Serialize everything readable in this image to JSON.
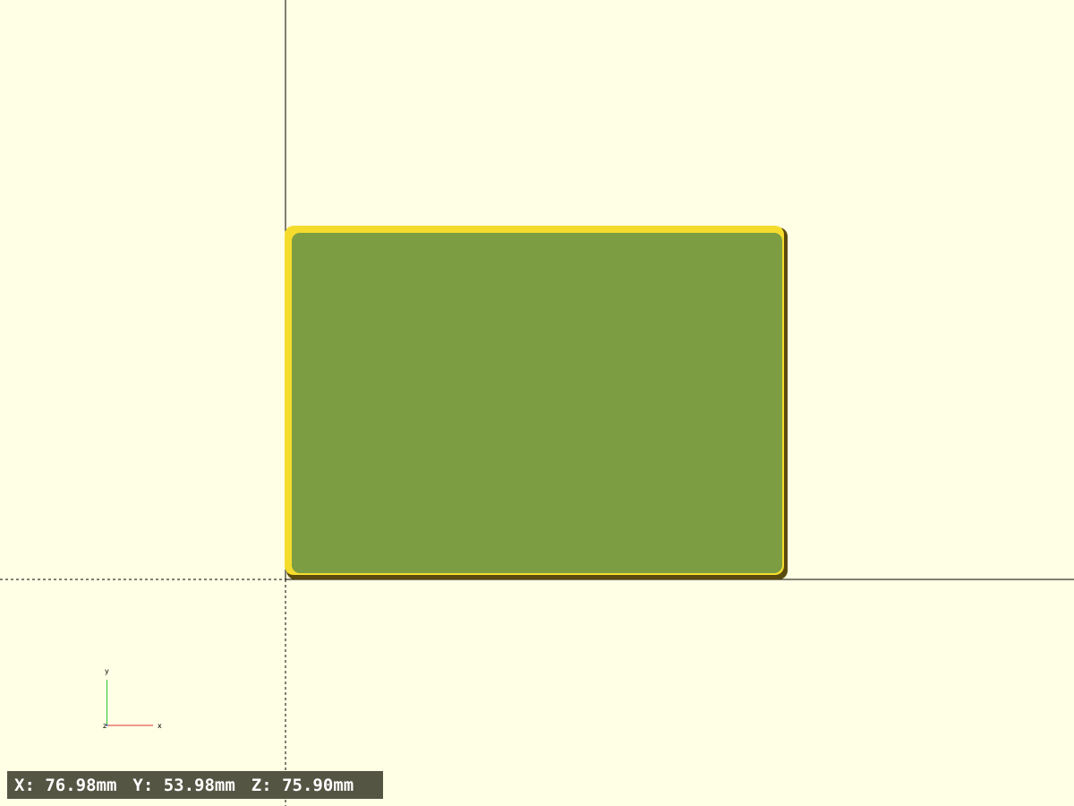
{
  "colors": {
    "background": "#FFFFE5",
    "model_face": "#7C9D42",
    "model_highlight": "#F5DC2C",
    "model_shadow": "#5A4A0E",
    "axis_line": "#000000",
    "axis_x": "#E03030",
    "axis_y": "#30C030",
    "axis_z": "#3050E0",
    "dims_bar_bg": "#555544",
    "dims_bar_text": "#FFFFFF"
  },
  "axes_gizmo": {
    "x_label": "x",
    "y_label": "y",
    "z_label": "z"
  },
  "dimensions": {
    "x": "X: 76.98mm",
    "y": "Y: 53.98mm",
    "z": "Z: 75.90mm"
  }
}
